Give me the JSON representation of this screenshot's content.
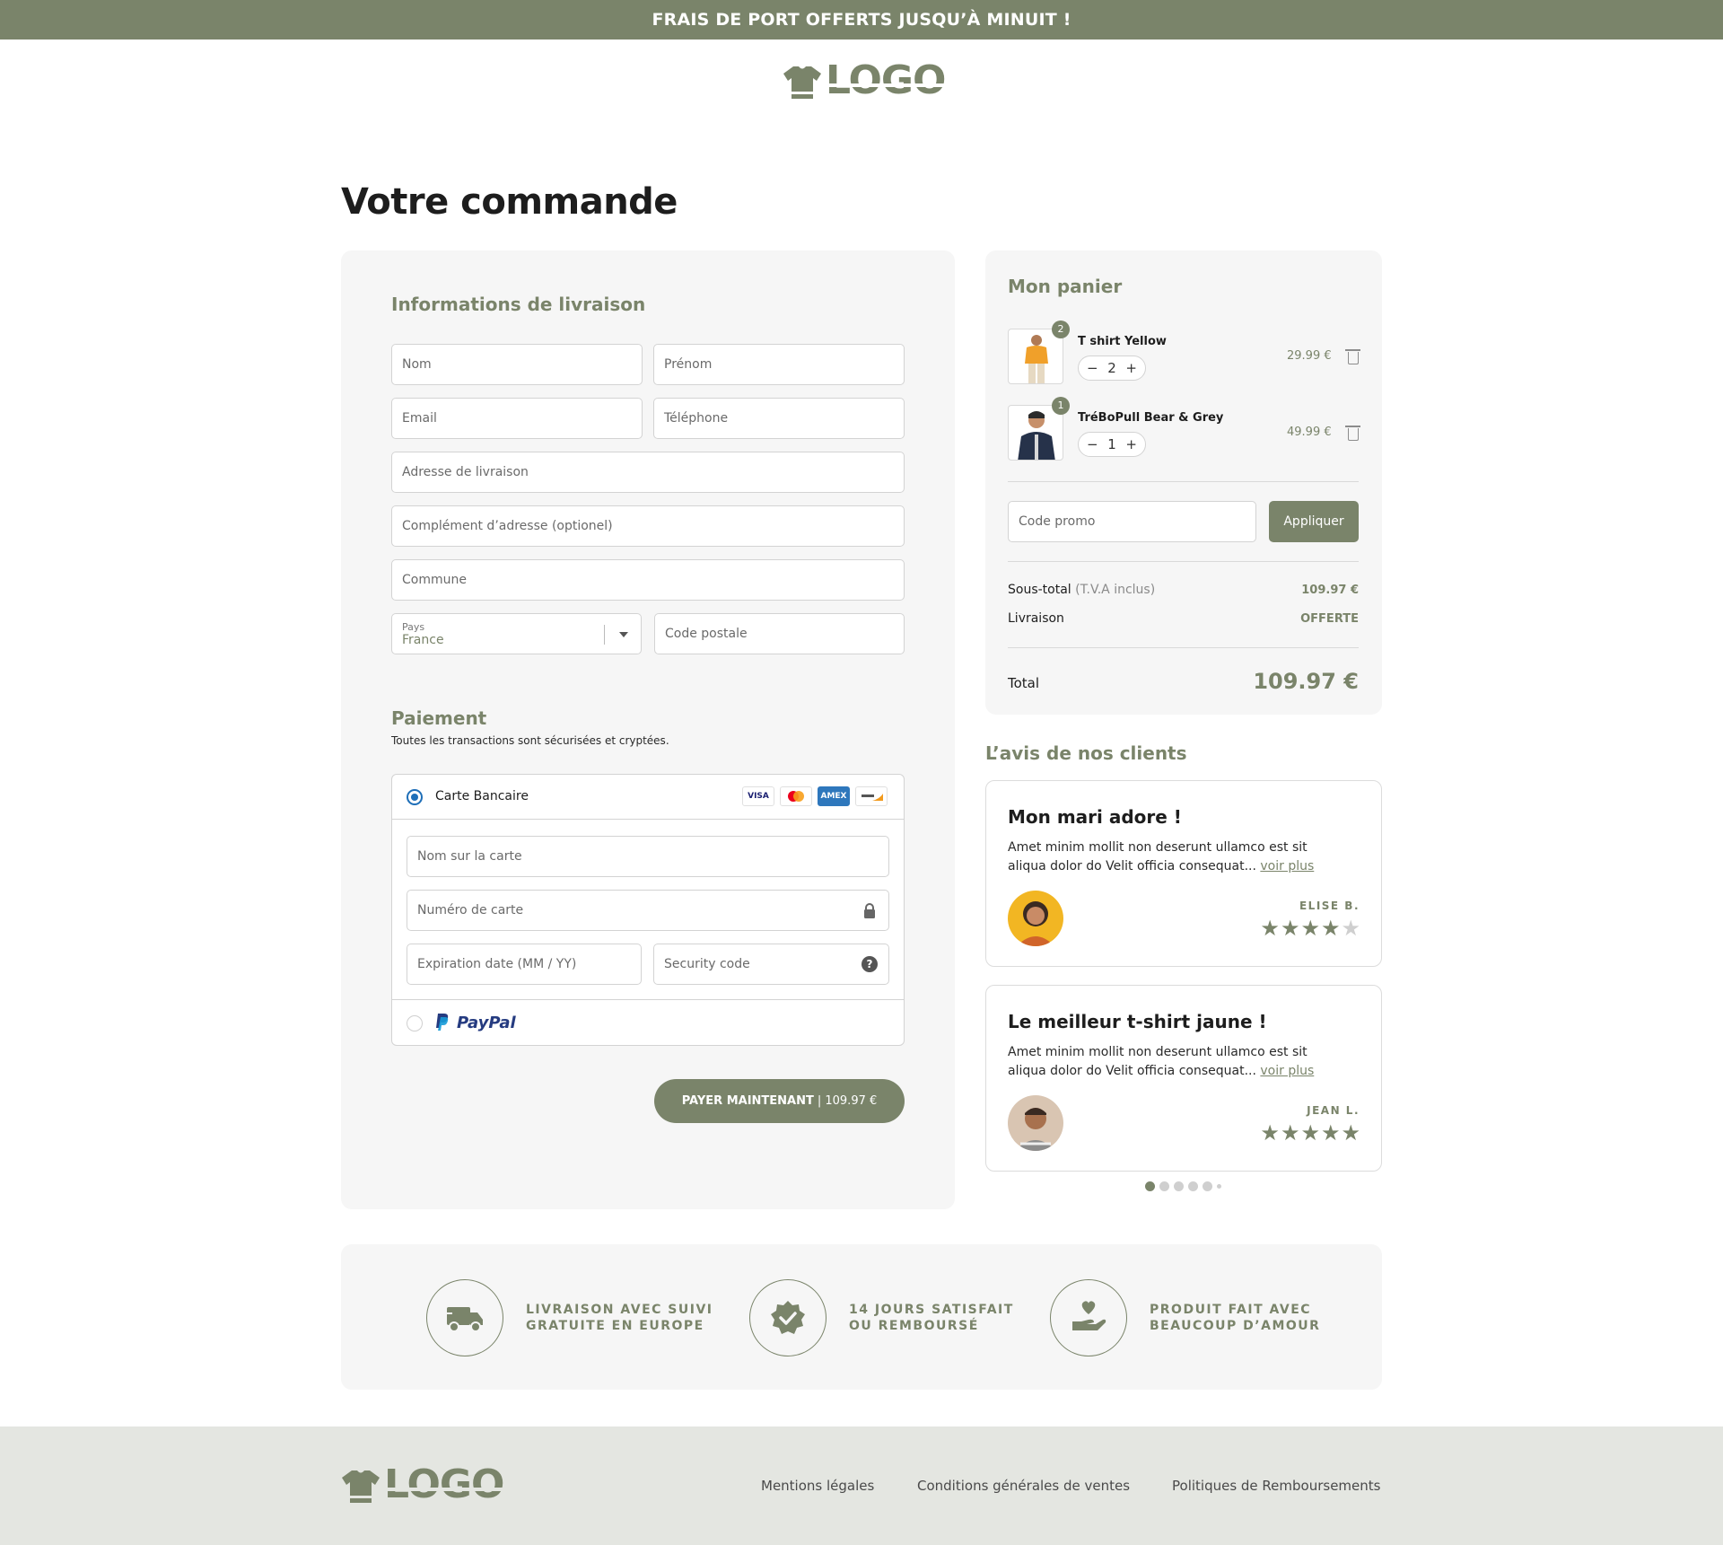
{
  "promo_banner": "FRAIS DE PORT OFFERTS JUSQU’À MINUIT !",
  "logo": {
    "text": "LOGO",
    "icon": "tshirt-icon"
  },
  "page_title": "Votre commande",
  "shipping": {
    "title": "Informations de livraison",
    "fields": {
      "nom": "Nom",
      "prenom": "Prénom",
      "email": "Email",
      "telephone": "Téléphone",
      "adresse": "Adresse de livraison",
      "complement": "Complément d’adresse (optionel)",
      "commune": "Commune",
      "pays_label": "Pays",
      "pays_value": "France",
      "code_postal": "Code postale"
    }
  },
  "payment": {
    "title": "Paiement",
    "subtitle": "Toutes les transactions sont sécurisées et cryptées.",
    "card_option": "Carte Bancaire",
    "card_logos": [
      "VISA",
      "MC",
      "AMEX",
      "DISC"
    ],
    "card_name": "Nom sur la carte",
    "card_number": "Numéro de carte",
    "expiration": "Expiration date (MM / YY)",
    "security": "Security code",
    "paypal_option": "PayPal",
    "pay_button_strong": "PAYER MAINTENANT",
    "pay_button_amount": "| 109.97 €"
  },
  "cart": {
    "title": "Mon panier",
    "items": [
      {
        "name": "T shirt Yellow",
        "qty": "2",
        "badge": "2",
        "price": "29.99 €"
      },
      {
        "name": "TréBoPull Bear & Grey",
        "qty": "1",
        "badge": "1",
        "price": "49.99 €"
      }
    ],
    "stepper_minus": "−",
    "stepper_plus": "+",
    "promo_placeholder": "Code promo",
    "apply_label": "Appliquer",
    "subtotal_label": "Sous-total",
    "subtotal_note": "(T.V.A inclus)",
    "subtotal_value": "109.97 €",
    "shipping_label": "Livraison",
    "shipping_value": "OFFERTE",
    "total_label": "Total",
    "total_value": "109.97 €"
  },
  "reviews": {
    "title": "L’avis de nos clients",
    "items": [
      {
        "title": "Mon mari adore !",
        "body": "Amet minim mollit non deserunt ullamco est sit aliqua dolor do Velit officia consequat...",
        "link": "voir plus",
        "author": "ELISE B.",
        "rating": 4
      },
      {
        "title": "Le meilleur t-shirt jaune !",
        "body": "Amet minim mollit non deserunt ullamco est sit aliqua dolor do Velit officia consequat...",
        "link": "voir plus",
        "author": "JEAN L.",
        "rating": 5
      }
    ],
    "dots_total": 6,
    "dots_active": 1
  },
  "features": [
    {
      "icon": "delivery-truck-icon",
      "line1": "LIVRAISON AVEC SUIVI",
      "line2": "GRATUITE EN EUROPE"
    },
    {
      "icon": "verified-badge-icon",
      "line1": "14 JOURS SATISFAIT",
      "line2": "OU REMBOURSÉ"
    },
    {
      "icon": "hand-heart-icon",
      "line1": "PRODUIT FAIT AVEC",
      "line2": "BEAUCOUP D’AMOUR"
    }
  ],
  "footer": {
    "links": [
      "Mentions légales",
      "Conditions générales de ventes",
      "Politiques de Remboursements"
    ]
  },
  "colors": {
    "accent": "#7a846a",
    "panel": "#f6f6f6",
    "footer": "#e4e6e1",
    "radio": "#1f6fb8"
  }
}
